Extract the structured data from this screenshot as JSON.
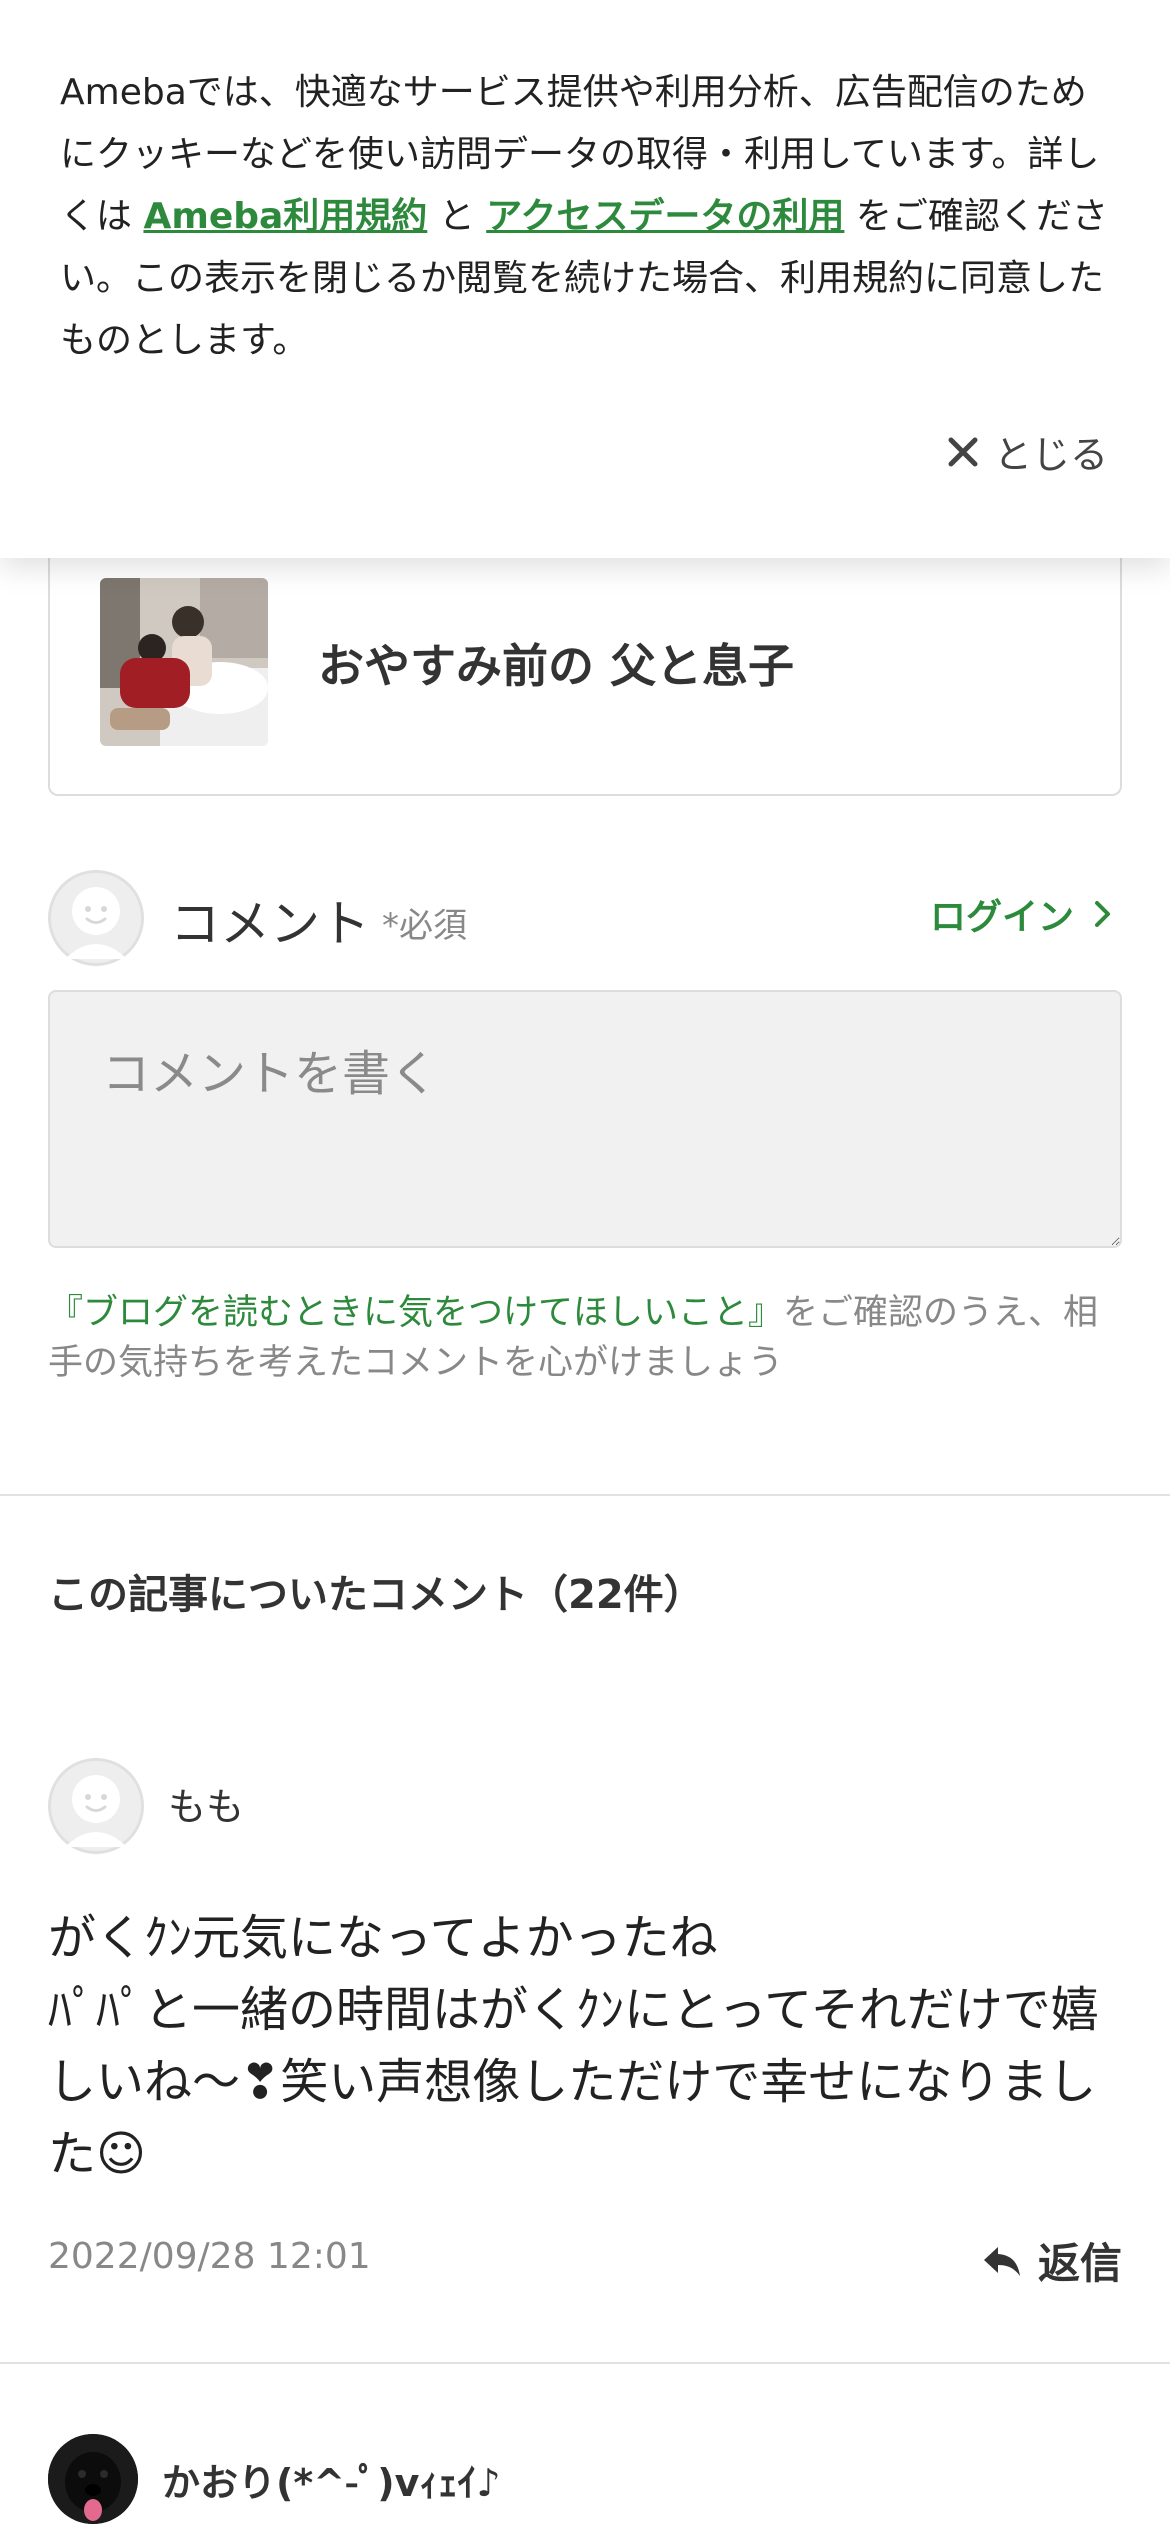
{
  "cookie_banner": {
    "text_before": "Amebaでは、快適なサービス提供や利用分析、広告配信のためにクッキーなどを使い訪問データの取得・利用しています。詳しくは ",
    "terms_link": "Ameba利用規約",
    "and_text": " と ",
    "access_link": "アクセスデータの利用",
    "text_after": " をご確認ください。この表示を閉じるか閲覧を続けた場合、利用規約に同意したものとします。",
    "close_label": "とじる",
    "close_icon": "close-icon"
  },
  "entry": {
    "title": "おやすみ前の 父と息子"
  },
  "comment_form": {
    "heading": "コメント",
    "required": "*必須",
    "login_label": "ログイン",
    "placeholder": "コメントを書く",
    "guideline_link": "『ブログを読むときに気をつけてほしいこと』",
    "guideline_text": "をご確認のうえ、相手の気持ちを考えたコメントを心がけましょう"
  },
  "comments_section": {
    "heading": "この記事についたコメント（22件）"
  },
  "comments": [
    {
      "name": "もも",
      "body_line1": "がくｸﾝ元気になってよかったね",
      "body_line2": "ﾊﾟﾊﾟと一緒の時間はがくｸﾝにとってそれだけで嬉しいね～❣笑い声想像しただけで幸せになりました☺",
      "timestamp": "2022/09/28 12:01",
      "reply_label": "返信"
    },
    {
      "name": "かおり(*^-ﾟ)vｨｪｲ♪"
    }
  ],
  "colors": {
    "accent_green": "#2d8a3c",
    "text": "#333333",
    "muted": "#888888"
  }
}
